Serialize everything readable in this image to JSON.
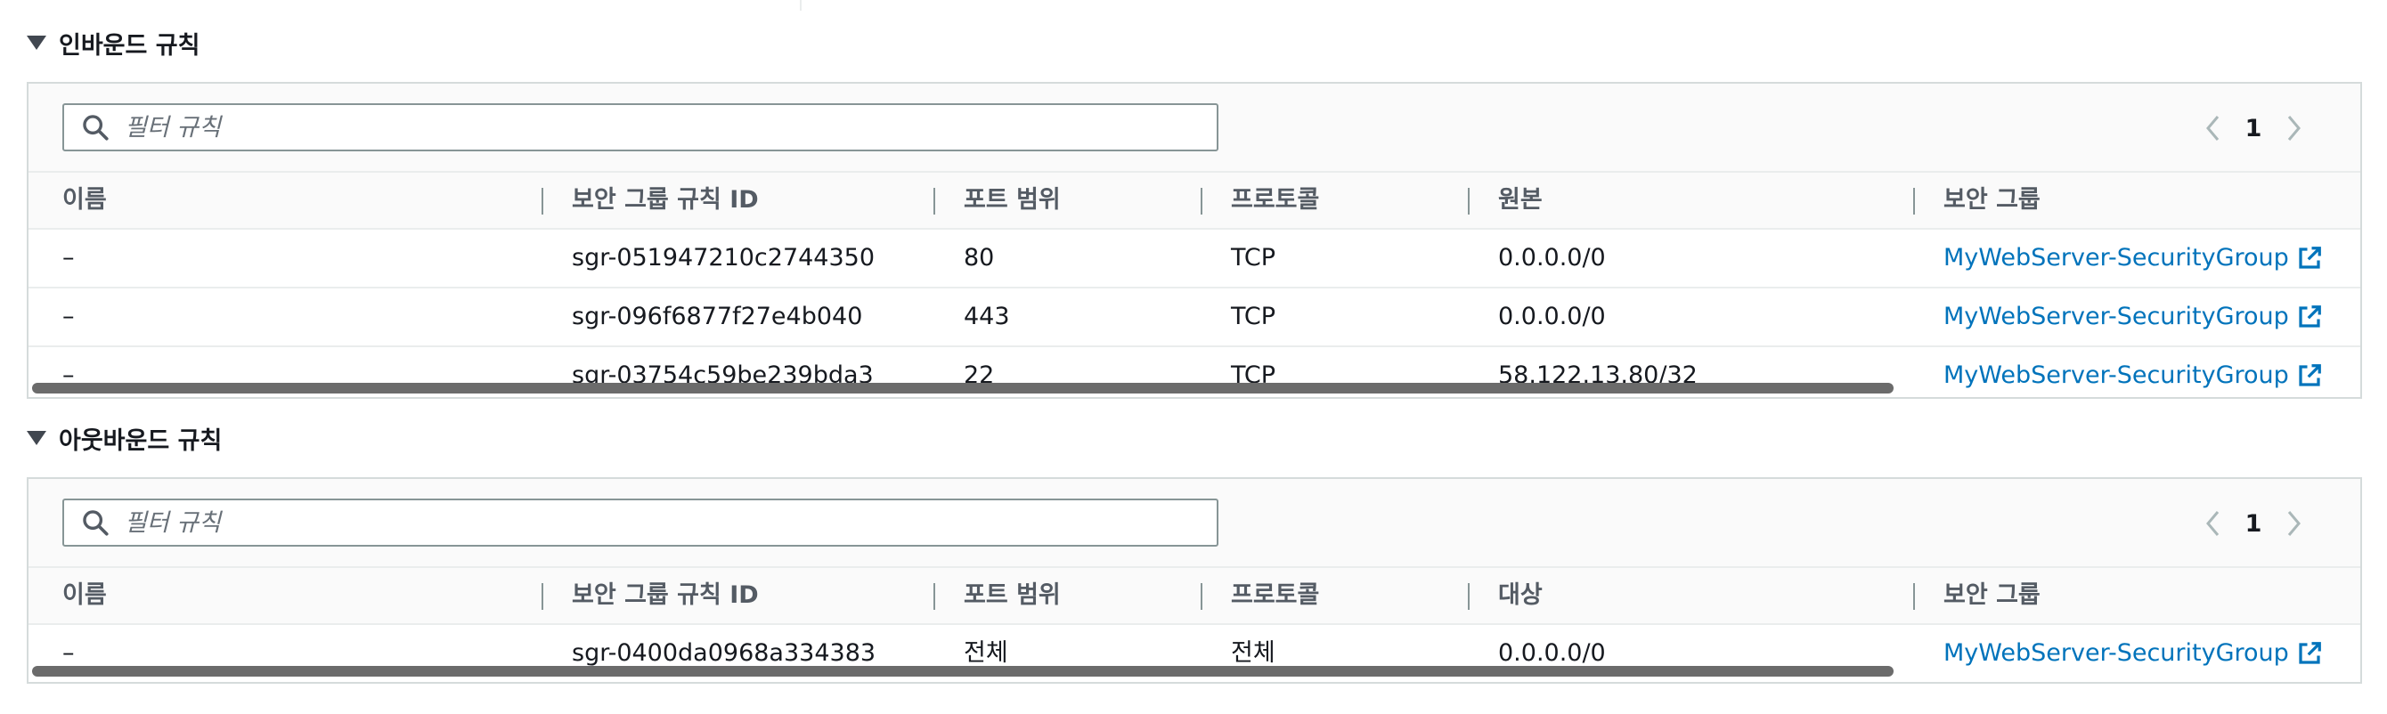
{
  "inbound": {
    "title": "인바운드 규칙",
    "search_placeholder": "필터 규칙",
    "page": "1",
    "columns": [
      "이름",
      "보안 그룹 규칙 ID",
      "포트 범위",
      "프로토콜",
      "원본",
      "보안 그룹"
    ],
    "rows": [
      {
        "name": "–",
        "rule_id": "sgr-051947210c2744350",
        "port": "80",
        "protocol": "TCP",
        "source": "0.0.0.0/0",
        "group": "MyWebServer-SecurityGroup"
      },
      {
        "name": "–",
        "rule_id": "sgr-096f6877f27e4b040",
        "port": "443",
        "protocol": "TCP",
        "source": "0.0.0.0/0",
        "group": "MyWebServer-SecurityGroup"
      },
      {
        "name": "–",
        "rule_id": "sgr-03754c59be239bda3",
        "port": "22",
        "protocol": "TCP",
        "source": "58.122.13.80/32",
        "group": "MyWebServer-SecurityGroup"
      }
    ]
  },
  "outbound": {
    "title": "아웃바운드 규칙",
    "search_placeholder": "필터 규칙",
    "page": "1",
    "columns": [
      "이름",
      "보안 그룹 규칙 ID",
      "포트 범위",
      "프로토콜",
      "대상",
      "보안 그룹"
    ],
    "rows": [
      {
        "name": "–",
        "rule_id": "sgr-0400da0968a334383",
        "port": "전체",
        "protocol": "전체",
        "source": "0.0.0.0/0",
        "group": "MyWebServer-SecurityGroup"
      }
    ]
  },
  "colors": {
    "link": "#0073bb",
    "border": "#d5dbdb",
    "header_text": "#545b64"
  },
  "icons": {
    "search": "search-icon",
    "external": "external-link-icon",
    "prev": "chevron-left-icon",
    "next": "chevron-right-icon",
    "caret": "caret-down-icon"
  }
}
